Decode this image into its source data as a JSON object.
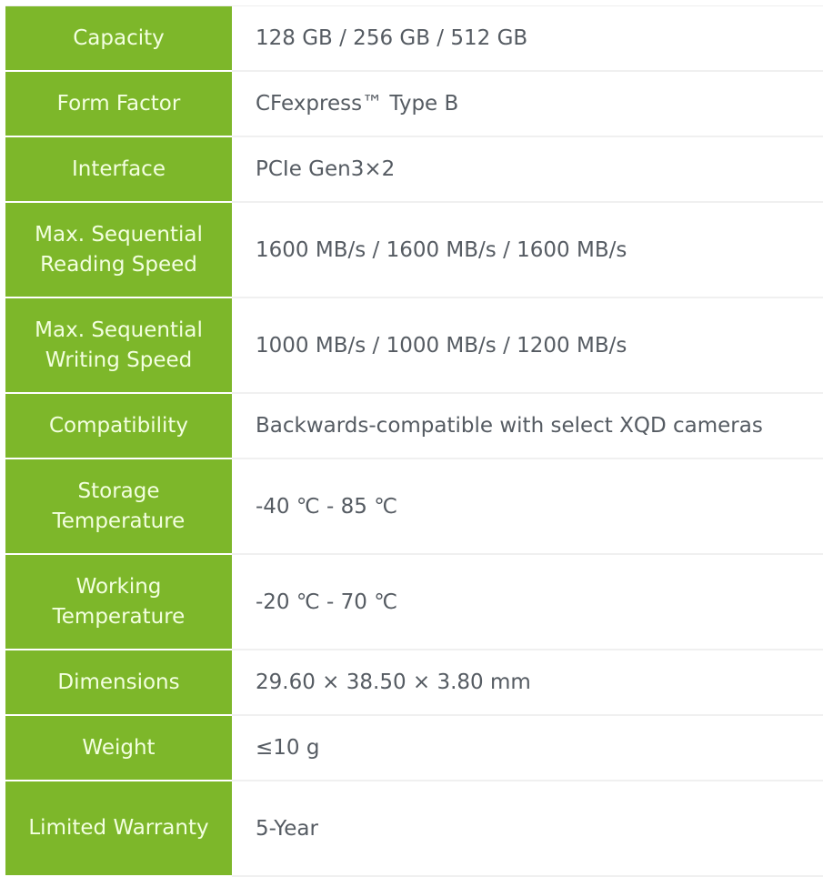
{
  "specs": [
    {
      "label": "Capacity",
      "value": "128 GB / 256 GB / 512 GB"
    },
    {
      "label": "Form Factor",
      "value": "CFexpress™ Type B"
    },
    {
      "label": "Interface",
      "value": "PCIe Gen3×2"
    },
    {
      "label": "Max. Sequential Reading Speed",
      "value": "1600 MB/s / 1600 MB/s / 1600 MB/s"
    },
    {
      "label": "Max. Sequential Writing Speed",
      "value": "1000 MB/s / 1000 MB/s / 1200 MB/s"
    },
    {
      "label": "Compatibility",
      "value": "Backwards-compatible with select XQD cameras"
    },
    {
      "label": "Storage Temperature",
      "value": "-40 ℃ - 85 ℃"
    },
    {
      "label": "Working Temperature",
      "value": "-20 ℃ - 70 ℃"
    },
    {
      "label": "Dimensions",
      "value": "29.60 × 38.50 × 3.80 mm"
    },
    {
      "label": "Weight",
      "value": "≤10 g"
    },
    {
      "label": "Limited Warranty",
      "value": "5-Year"
    }
  ],
  "colors": {
    "label_bg": "#7db72a",
    "label_text": "#f3ffe0",
    "value_text": "#555b62"
  }
}
